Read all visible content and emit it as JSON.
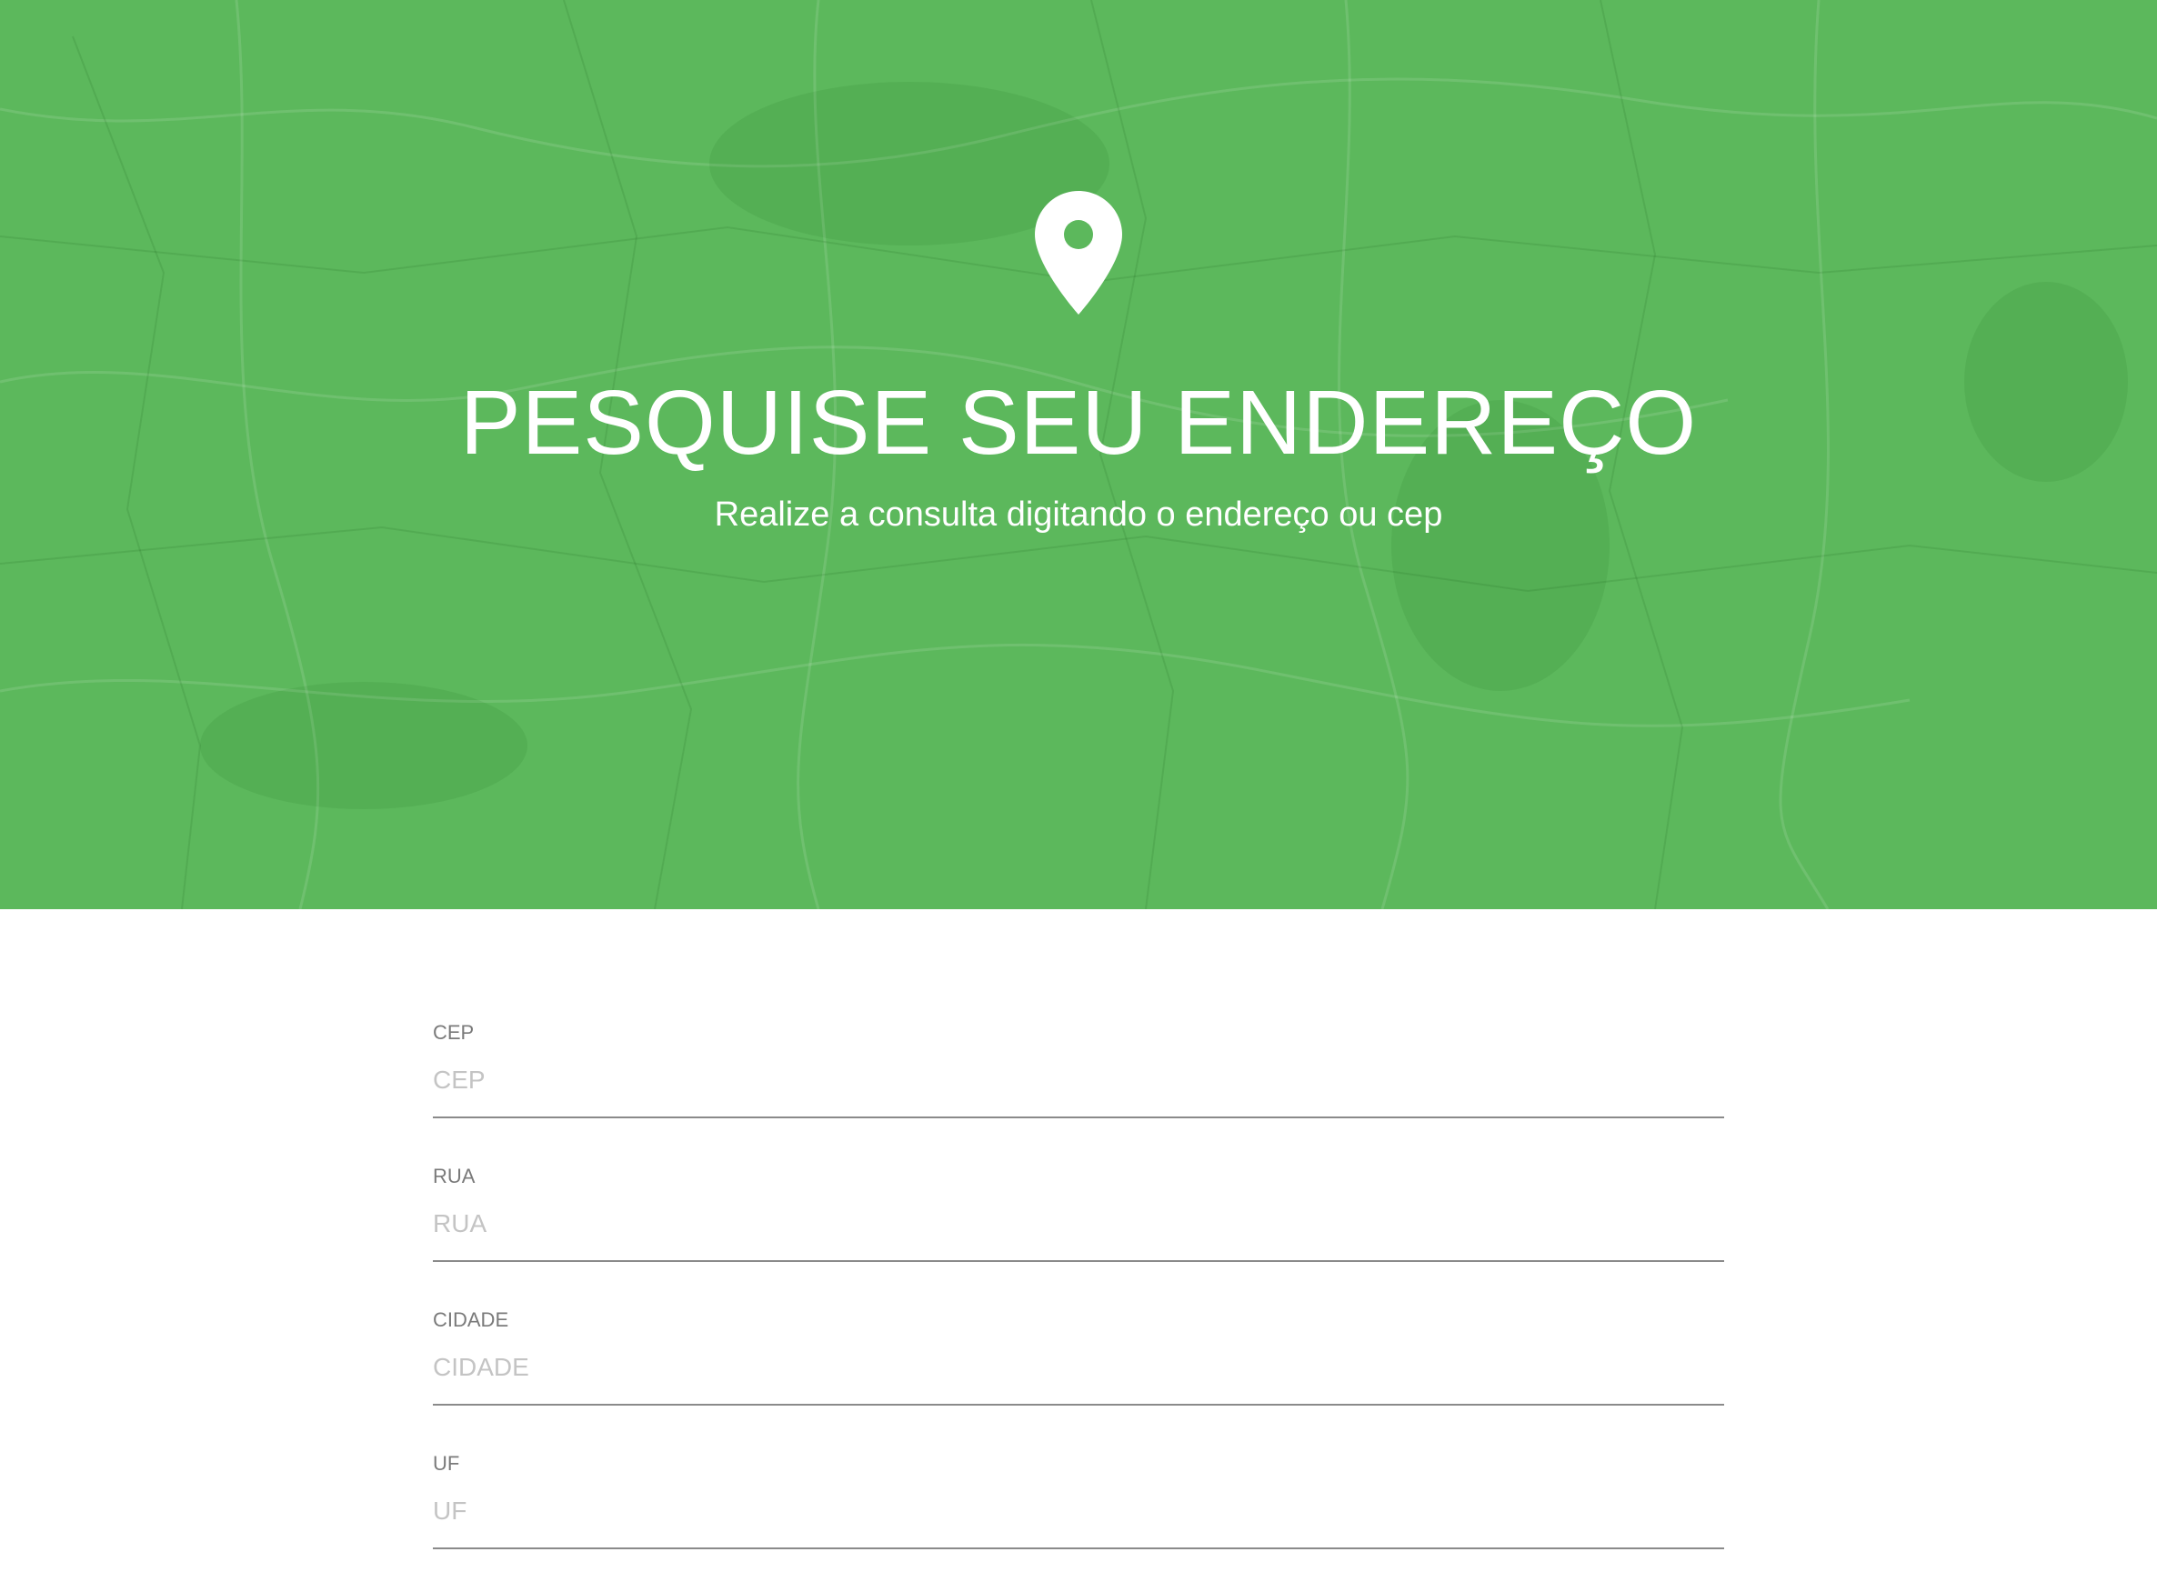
{
  "hero": {
    "title": "PESQUISE SEU ENDEREÇO",
    "subtitle": "Realize a consulta digitando o endereço ou cep",
    "icon": "map-pin-icon",
    "background_color": "#5cb85c"
  },
  "form": {
    "fields": [
      {
        "label": "CEP",
        "placeholder": "CEP"
      },
      {
        "label": "RUA",
        "placeholder": "RUA"
      },
      {
        "label": "CIDADE",
        "placeholder": "CIDADE"
      },
      {
        "label": "UF",
        "placeholder": "UF"
      }
    ]
  }
}
